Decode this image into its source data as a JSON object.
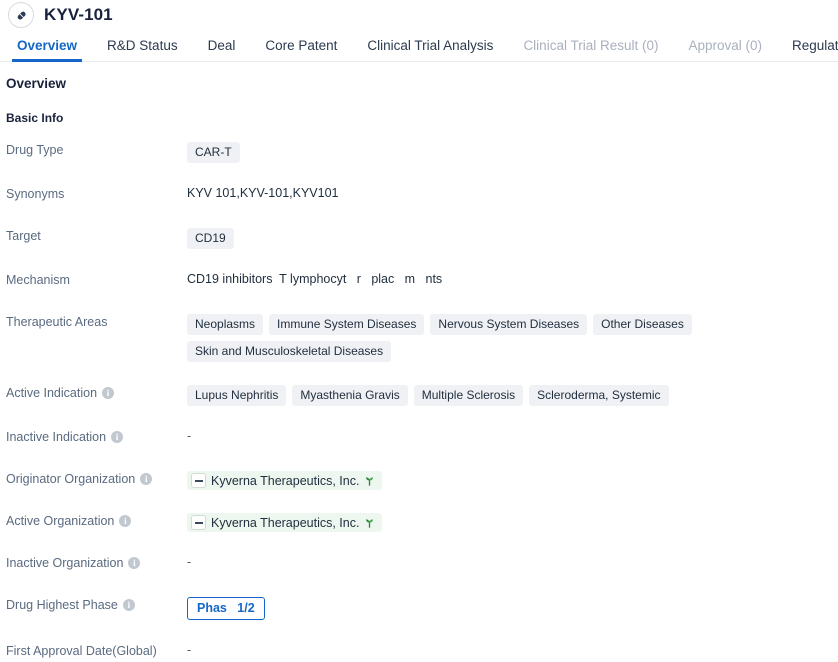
{
  "header": {
    "title": "KYV-101",
    "icon": "pill-capsule-icon"
  },
  "tabs": [
    {
      "label": "Overview",
      "state": "active"
    },
    {
      "label": "R&D Status",
      "state": "normal"
    },
    {
      "label": "Deal",
      "state": "normal"
    },
    {
      "label": "Core Patent",
      "state": "normal"
    },
    {
      "label": "Clinical Trial Analysis",
      "state": "normal"
    },
    {
      "label": "Clinical Trial Result (0)",
      "state": "disabled"
    },
    {
      "label": "Approval (0)",
      "state": "disabled"
    },
    {
      "label": "Regulation",
      "state": "normal"
    }
  ],
  "overview": {
    "section_title": "Overview",
    "subsection_title": "Basic Info",
    "rows": {
      "drug_type": {
        "label": "Drug Type",
        "tags": [
          "CAR-T"
        ]
      },
      "synonyms": {
        "label": "Synonyms",
        "value": "KYV 101,KYV-101,KYV101"
      },
      "target": {
        "label": "Target",
        "tags": [
          "CD19"
        ]
      },
      "mechanism": {
        "label": "Mechanism",
        "value": "CD19 inhibitors  T lymphocyt   r   plac   m   nts"
      },
      "therapeutic_areas": {
        "label": "Therapeutic Areas",
        "tags": [
          "Neoplasms",
          "Immune System Diseases",
          "Nervous System Diseases",
          "Other Diseases",
          "Skin and Musculoskeletal Diseases"
        ]
      },
      "active_indication": {
        "label": "Active Indication",
        "has_info": true,
        "tags": [
          "Lupus Nephritis",
          "Myasthenia Gravis",
          "Multiple Sclerosis",
          "Scleroderma, Systemic"
        ]
      },
      "inactive_indication": {
        "label": "Inactive Indication",
        "has_info": true,
        "value": "-"
      },
      "originator_organization": {
        "label": "Originator Organization",
        "has_info": true,
        "org": "Kyverna Therapeutics, Inc."
      },
      "active_organization": {
        "label": "Active Organization",
        "has_info": true,
        "org": "Kyverna Therapeutics, Inc."
      },
      "inactive_organization": {
        "label": "Inactive Organization",
        "has_info": true,
        "value": "-"
      },
      "drug_highest_phase": {
        "label": "Drug Highest Phase",
        "has_info": true,
        "badge": "Phas   1/2"
      },
      "first_approval_date": {
        "label": "First Approval Date(Global)",
        "value": "-"
      }
    }
  },
  "icons": {
    "info": "i"
  },
  "colors": {
    "accent": "#1467c8",
    "label": "#5a6a80",
    "tag_bg": "#f0f1f4",
    "org_bg": "#eef7ef",
    "sprout_green": "#2f8a3f"
  }
}
